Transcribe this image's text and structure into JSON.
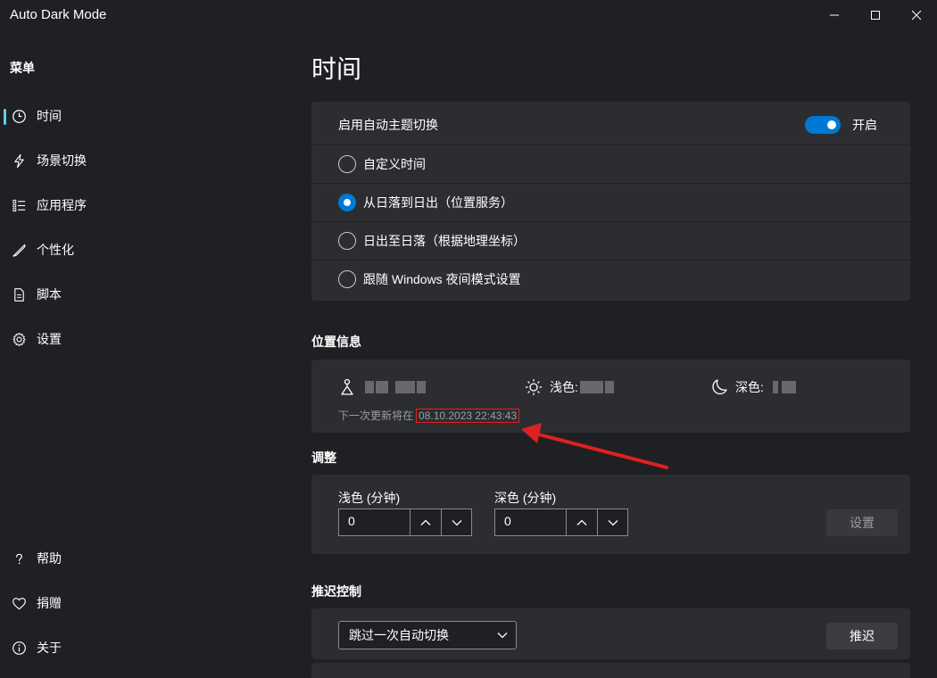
{
  "window": {
    "title": "Auto Dark Mode"
  },
  "sidebar": {
    "header": "菜单",
    "items": [
      {
        "label": "时间",
        "icon": "clock-icon"
      },
      {
        "label": "场景切换",
        "icon": "lightning-icon"
      },
      {
        "label": "应用程序",
        "icon": "list-icon"
      },
      {
        "label": "个性化",
        "icon": "brush-icon"
      },
      {
        "label": "脚本",
        "icon": "document-icon"
      },
      {
        "label": "设置",
        "icon": "gear-icon"
      }
    ],
    "footer": [
      {
        "label": "帮助",
        "icon": "question-icon"
      },
      {
        "label": "捐赠",
        "icon": "heart-icon"
      },
      {
        "label": "关于",
        "icon": "info-icon"
      }
    ]
  },
  "main": {
    "title": "时间",
    "auto_switch": {
      "label": "启用自动主题切换",
      "toggle_state": "开启"
    },
    "options": [
      {
        "label": "自定义时间",
        "checked": false
      },
      {
        "label": "从日落到日出（位置服务）",
        "checked": true
      },
      {
        "label": "日出至日落（根据地理坐标）",
        "checked": false
      },
      {
        "label": "跟随 Windows 夜间模式设置",
        "checked": false
      }
    ],
    "location": {
      "section_title": "位置信息",
      "light_label": "浅色:",
      "dark_label": "深色:",
      "update_prefix": "下一次更新将在",
      "update_time": "08.10.2023 22:43:43"
    },
    "adjust": {
      "section_title": "调整",
      "light_label": "浅色 (分钟)",
      "light_value": "0",
      "dark_label": "深色 (分钟)",
      "dark_value": "0",
      "set_button": "设置"
    },
    "postpone": {
      "section_title": "推迟控制",
      "dropdown_value": "跳过一次自动切换",
      "button": "推迟"
    }
  },
  "colors": {
    "background": "#1f2024",
    "card": "#2b2d31",
    "accent": "#0078d4",
    "highlight": "#e02020"
  }
}
